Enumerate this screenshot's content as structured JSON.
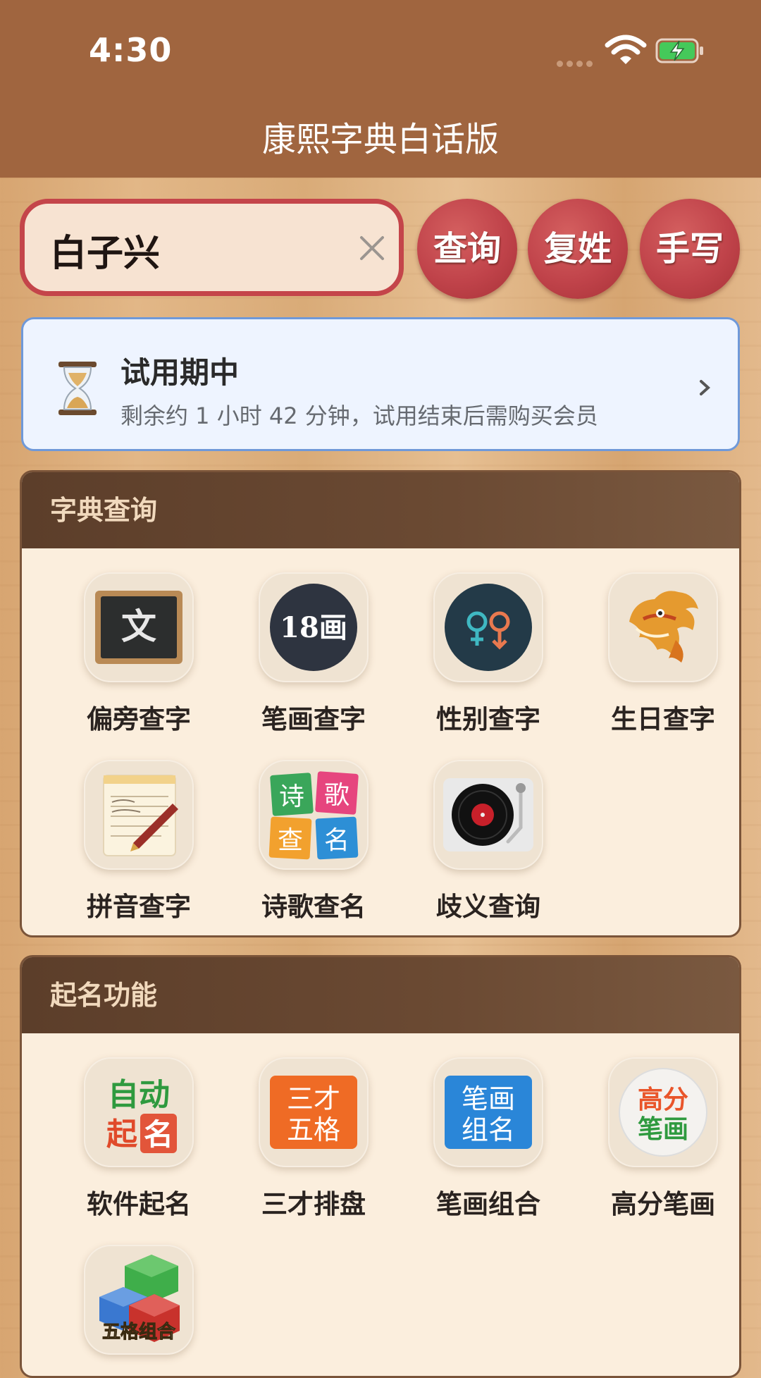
{
  "status_bar": {
    "time": "4:30"
  },
  "header": {
    "title": "康熙字典白话版"
  },
  "search": {
    "value": "白子兴"
  },
  "actions": {
    "query": "查询",
    "compound_surname": "复姓",
    "handwriting": "手写"
  },
  "trial": {
    "title": "试用期中",
    "subtitle": "剩余约 1 小时 42 分钟，试用结束后需购买会员"
  },
  "dictionary_section": {
    "title": "字典查询",
    "items": [
      {
        "label": "偏旁查字",
        "icon": "chalkboard-icon",
        "icon_text": "文"
      },
      {
        "label": "笔画查字",
        "icon": "stroke-count-icon",
        "icon_text": "18画"
      },
      {
        "label": "性别查字",
        "icon": "gender-icon"
      },
      {
        "label": "生日查字",
        "icon": "dragon-icon"
      },
      {
        "label": "拼音查字",
        "icon": "notepad-icon"
      },
      {
        "label": "诗歌查名",
        "icon": "poem-tiles-icon",
        "icon_chars": [
          "诗",
          "歌",
          "查",
          "名"
        ]
      },
      {
        "label": "歧义查询",
        "icon": "turntable-icon"
      }
    ]
  },
  "naming_section": {
    "title": "起名功能",
    "items": [
      {
        "label": "软件起名",
        "icon": "auto-name-icon",
        "icon_chars": [
          "自动",
          "起",
          "名"
        ]
      },
      {
        "label": "三才排盘",
        "icon": "sancai-icon",
        "icon_chars": [
          "三才",
          "五格"
        ]
      },
      {
        "label": "笔画组合",
        "icon": "stroke-combo-icon",
        "icon_chars": [
          "笔画",
          "组名"
        ]
      },
      {
        "label": "高分笔画",
        "icon": "high-score-icon",
        "icon_chars": [
          "高分",
          "笔画"
        ]
      },
      {
        "label": "五格组合",
        "icon": "cubes-icon",
        "icon_text": "五格组合"
      }
    ]
  },
  "colors": {
    "header_bg": "#a0653f",
    "accent_red": "#c0434a",
    "section_head": "#5c3e2a",
    "panel_bg": "#fbeedd",
    "trial_border": "#6f99d9"
  }
}
